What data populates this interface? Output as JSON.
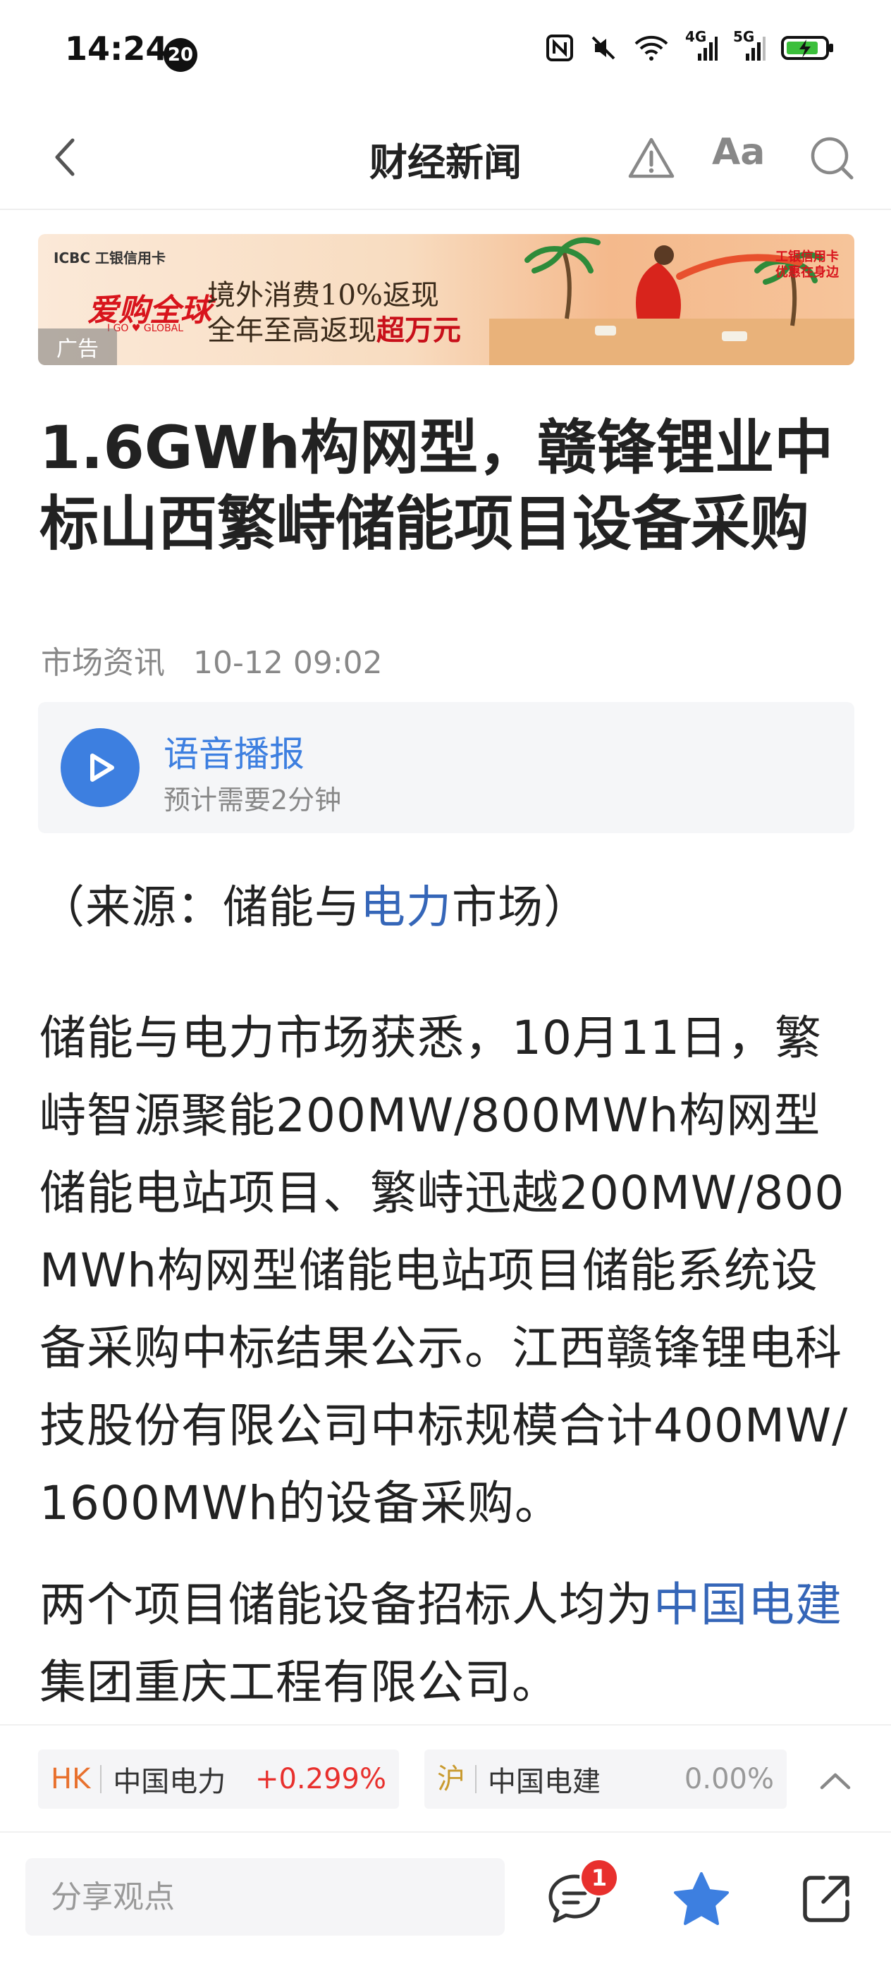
{
  "status_bar": {
    "time": "14:24",
    "notif_count": "20",
    "net1": "4G",
    "net2": "5G"
  },
  "nav": {
    "title": "财经新闻",
    "font_label": "Aa"
  },
  "ad": {
    "brand": "ICBC 工银信用卡",
    "logo": "爱购全球",
    "logo_sub": "I GO ♥ GLOBAL",
    "line1": "境外消费10%返现",
    "line2_prefix": "全年至高返现",
    "line2_highlight": "超万元",
    "right_tag_1": "工银信用卡",
    "right_tag_2": "优惠在身边",
    "tag": "广告"
  },
  "article": {
    "title": "1.6GWh构网型，赣锋锂业中标山西繁峙储能项目设备采购",
    "source": "市场资讯",
    "datetime": "10-12 09:02",
    "audio_title": "语音播报",
    "audio_duration": "预计需要2分钟",
    "source_prefix": "（来源：储能与",
    "source_link": "电力",
    "source_suffix": "市场）",
    "para1": "储能与电力市场获悉，10月11日，繁峙智源聚能200MW/800MWh构网型储能电站项目、繁峙迅越200MW/800MWh构网型储能电站项目储能系统设备采购中标结果公示。江西赣锋锂电科技股份有限公司中标规模合计400MW/1600MWh的设备采购。",
    "para2_prefix": "两个项目储能设备招标人均为",
    "para2_link": "中国电建",
    "para2_suffix": "集团重庆工程有限公司。"
  },
  "stocks": [
    {
      "exchange": "HK",
      "name": "中国电力",
      "change": "+0.299%",
      "exchange_color": "#e8702d",
      "change_color": "#e8302d"
    },
    {
      "exchange": "沪",
      "name": "中国电建",
      "change": "0.00%",
      "exchange_color": "#c99a2e",
      "change_color": "#999999"
    }
  ],
  "bottom": {
    "share_placeholder": "分享观点",
    "comment_count": "1"
  },
  "colors": {
    "accent": "#3d7fe0",
    "link": "#3566b8",
    "badge": "#e8302d"
  }
}
